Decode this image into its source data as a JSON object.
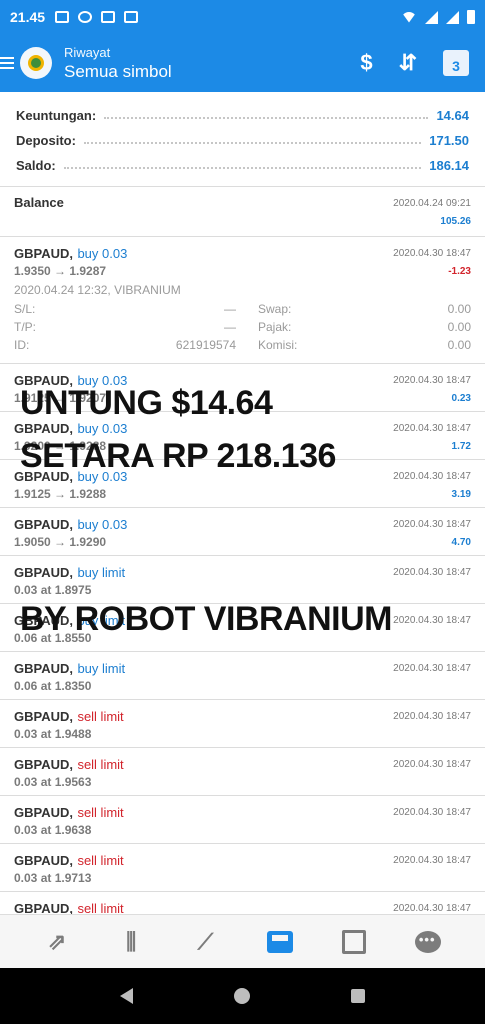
{
  "status_bar": {
    "time": "21.45"
  },
  "app_bar": {
    "subtitle": "Riwayat",
    "title": "Semua simbol",
    "actions": {
      "symbol_icon": "$",
      "sort_icon": "⇵",
      "calendar_day": "3"
    }
  },
  "summary": [
    {
      "label": "Keuntungan:",
      "value": "14.64"
    },
    {
      "label": "Deposito:",
      "value": "171.50"
    },
    {
      "label": "Saldo:",
      "value": "186.14"
    }
  ],
  "balance": {
    "label": "Balance",
    "date": "2020.04.24 09:21",
    "value": "105.26"
  },
  "expanded_trade": {
    "symbol": "GBPAUD,",
    "side": "buy 0.03",
    "prices": "1.9350 → 1.9287",
    "date": "2020.04.30 18:47",
    "profit": "-1.23",
    "open_info": "2020.04.24 12:32, VIBRANIUM",
    "sl_label": "S/L:",
    "sl_value": "—",
    "swap_label": "Swap:",
    "swap_value": "0.00",
    "tp_label": "T/P:",
    "tp_value": "—",
    "tax_label": "Pajak:",
    "tax_value": "0.00",
    "id_label": "ID:",
    "id_value": "621919574",
    "commission_label": "Komisi:",
    "commission_value": "0.00"
  },
  "trades": [
    {
      "symbol": "GBPAUD,",
      "side": "buy 0.03",
      "sub": "1.9125 → 1.9207",
      "date": "2020.04.30 18:47",
      "profit": "0.23",
      "color": "#1c7ed0"
    },
    {
      "symbol": "GBPAUD,",
      "side": "buy 0.03",
      "sub": "1.9200 → 1.9288",
      "date": "2020.04.30 18:47",
      "profit": "1.72",
      "color": "#1c7ed0"
    },
    {
      "symbol": "GBPAUD,",
      "side": "buy 0.03",
      "sub": "1.9125 → 1.9288",
      "date": "2020.04.30 18:47",
      "profit": "3.19",
      "color": "#1c7ed0"
    },
    {
      "symbol": "GBPAUD,",
      "side": "buy 0.03",
      "sub": "1.9050 → 1.9290",
      "date": "2020.04.30 18:47",
      "profit": "4.70",
      "color": "#1c7ed0"
    }
  ],
  "orders": [
    {
      "symbol": "GBPAUD,",
      "side": "buy limit",
      "sub": "0.03 at 1.8975",
      "date": "2020.04.30 18:47",
      "side_color": "#1c7ed0"
    },
    {
      "symbol": "GBPAUD,",
      "side": "buy limit",
      "sub": "0.06 at 1.8550",
      "date": "2020.04.30 18:47",
      "side_color": "#1c7ed0"
    },
    {
      "symbol": "GBPAUD,",
      "side": "buy limit",
      "sub": "0.06 at 1.8350",
      "date": "2020.04.30 18:47",
      "side_color": "#1c7ed0"
    },
    {
      "symbol": "GBPAUD,",
      "side": "sell limit",
      "sub": "0.03 at 1.9488",
      "date": "2020.04.30 18:47",
      "side_color": "#d2242c"
    },
    {
      "symbol": "GBPAUD,",
      "side": "sell limit",
      "sub": "0.03 at 1.9563",
      "date": "2020.04.30 18:47",
      "side_color": "#d2242c"
    },
    {
      "symbol": "GBPAUD,",
      "side": "sell limit",
      "sub": "0.03 at 1.9638",
      "date": "2020.04.30 18:47",
      "side_color": "#d2242c"
    },
    {
      "symbol": "GBPAUD,",
      "side": "sell limit",
      "sub": "0.03 at 1.9713",
      "date": "2020.04.30 18:47",
      "side_color": "#d2242c"
    },
    {
      "symbol": "GBPAUD,",
      "side": "sell limit",
      "sub": "",
      "date": "2020.04.30 18:47",
      "side_color": "#d2242c"
    }
  ],
  "overlay": {
    "line1": "UNTUNG $14.64",
    "line2": "SETARA RP 218.136",
    "line3": "BY ROBOT VIBRANIUM"
  },
  "tab_bar": [
    {
      "name": "quotes-icon",
      "glyph": "⇗"
    },
    {
      "name": "chart-icon",
      "glyph": "⫼"
    },
    {
      "name": "trade-icon",
      "glyph": "⟋"
    },
    {
      "name": "history-icon",
      "glyph": ""
    },
    {
      "name": "news-icon",
      "glyph": ""
    },
    {
      "name": "chat-icon",
      "glyph": ""
    }
  ],
  "colors": {
    "primary": "#1c8ae6",
    "profit": "#1c7ed0",
    "loss": "#d2242c"
  }
}
